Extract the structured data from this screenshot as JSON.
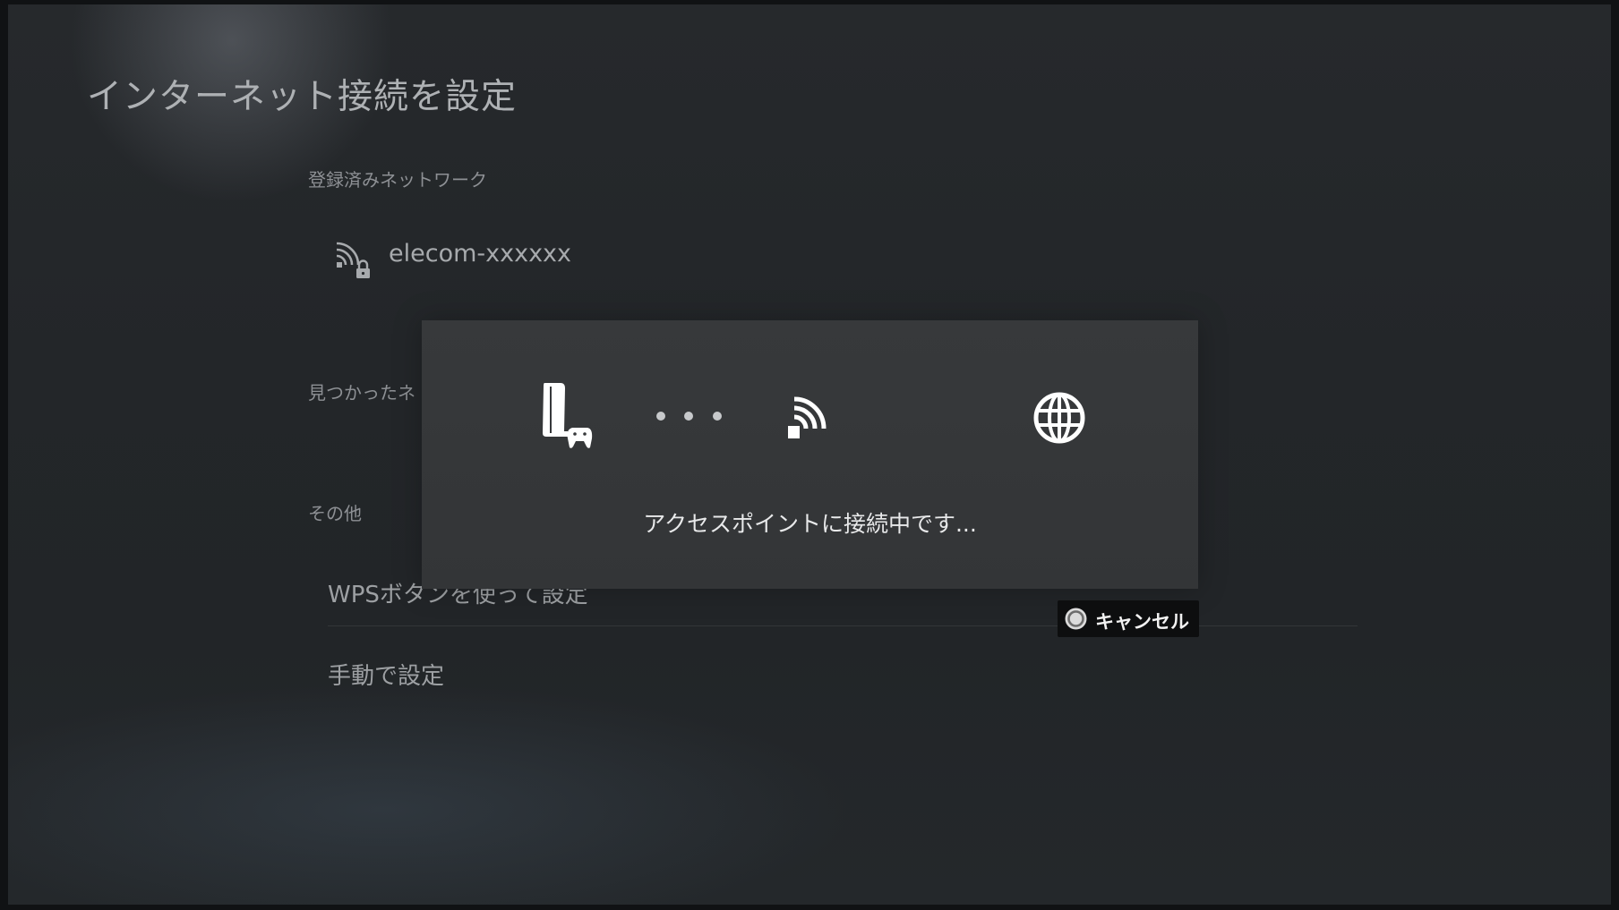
{
  "header": {
    "title": "インターネット接続を設定"
  },
  "registered": {
    "heading": "登録済みネットワーク",
    "networks": [
      {
        "ssid": "elecom-xxxxxx",
        "icon": "wifi-locked-icon"
      }
    ]
  },
  "found": {
    "heading": "見つかったネ"
  },
  "other": {
    "heading": "その他",
    "items": [
      {
        "label": "WPSボタンを使って設定"
      },
      {
        "label": "手動で設定"
      }
    ]
  },
  "dialog": {
    "status": "アクセスポイントに接続中です...",
    "icons": [
      "ps5-console-icon",
      "wifi-access-point-icon",
      "globe-icon"
    ]
  },
  "footer": {
    "cancel_label": "キャンセル",
    "cancel_icon": "circle-button-icon"
  },
  "colors": {
    "background": "#232629",
    "dialog": "#36383a",
    "text_primary": "#e8e9ea",
    "text_dim": "#9da0a3"
  }
}
